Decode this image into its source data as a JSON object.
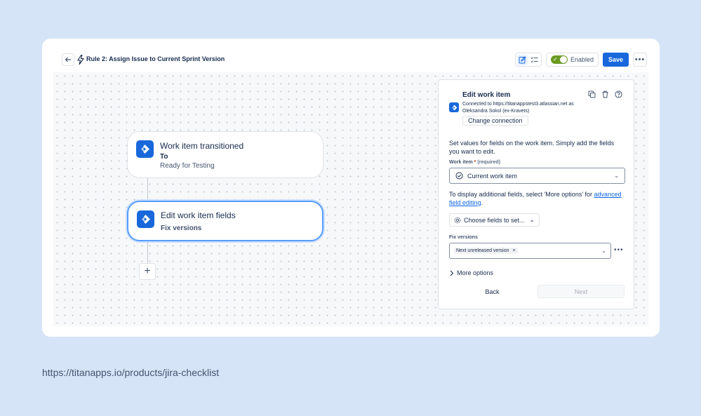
{
  "header": {
    "rule_title": "Rule 2: Assign Issue to Current Sprint Version",
    "enabled_label": "Enabled",
    "save_label": "Save",
    "more_label": "•••"
  },
  "nodes": [
    {
      "title": "Work item transitioned",
      "sub_bold": "To",
      "sub": "Ready for Testing"
    },
    {
      "title": "Edit work item fields",
      "sub_bold": "Fix versions"
    }
  ],
  "add_label": "+",
  "panel": {
    "title": "Edit work item",
    "connection": "Connected to https://titanappstest3.atlassian.net as Oleksandra Sokol (ex-Kravets)",
    "change_connection": "Change connection",
    "description": "Set values for fields on the work item. Simply add the fields you want to edit.",
    "work_item_label": "Work item",
    "required_star": "*",
    "required_text": "(required)",
    "work_item_value": "Current work item",
    "note_prefix": "To display additional fields, select 'More options' for ",
    "note_link": "advanced field editing",
    "note_suffix": ".",
    "choose_fields": "Choose fields to set...",
    "fix_versions_label": "Fix versions",
    "fix_versions_tag": "Next unreleased version",
    "tag_remove": "×",
    "more_options": "More options",
    "back": "Back",
    "next": "Next",
    "dots": "•••"
  },
  "footer_url": "https://titanapps.io/products/jira-checklist",
  "colors": {
    "brand": "#1868db",
    "toggle": "#6a9a23",
    "background": "#d6e4f7"
  }
}
